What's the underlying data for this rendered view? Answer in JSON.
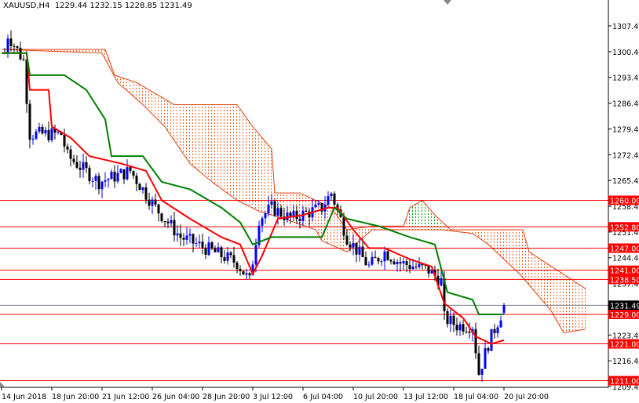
{
  "header": {
    "symbol": "XAUUSD,H4",
    "ohlc": "1229.44 1232.15 1228.85 1231.49"
  },
  "chart_data": {
    "type": "candlestick",
    "title": "XAUUSD,H4",
    "ohlc": {
      "open": 1229.44,
      "high": 1232.15,
      "low": 1228.85,
      "close": 1231.49
    },
    "y_ticks": [
      "1307.40",
      "1300.40",
      "1293.40",
      "1286.40",
      "1279.40",
      "1272.40",
      "1265.40",
      "1258.40",
      "1251.40",
      "1244.40",
      "1237.40",
      "1230.40",
      "1223.40",
      "1216.40",
      "1209.40"
    ],
    "ylim": [
      1207.5,
      1314.5
    ],
    "x_ticks": [
      {
        "bar": 0,
        "label": "14 Jun 2018"
      },
      {
        "bar": 16,
        "label": "18 Jun 20:00"
      },
      {
        "bar": 32,
        "label": "21 Jun 12:00"
      },
      {
        "bar": 48,
        "label": "26 Jun 04:00"
      },
      {
        "bar": 64,
        "label": "28 Jun 20:00"
      },
      {
        "bar": 80,
        "label": "3 Jul 12:00"
      },
      {
        "bar": 96,
        "label": "6 Jul 04:00"
      },
      {
        "bar": 112,
        "label": "10 Jul 20:00"
      },
      {
        "bar": 128,
        "label": "13 Jul 12:00"
      },
      {
        "bar": 144,
        "label": "18 Jul 04:00"
      },
      {
        "bar": 160,
        "label": "20 Jul 20:00"
      }
    ],
    "levels": [
      {
        "price": 1260.0,
        "label": "1260.00"
      },
      {
        "price": 1252.8,
        "label": "1252.80"
      },
      {
        "price": 1247.0,
        "label": "1247.00"
      },
      {
        "price": 1241.0,
        "label": "1241.00"
      },
      {
        "price": 1238.5,
        "label": "1238.50"
      },
      {
        "price": 1229.0,
        "label": "1229.00"
      },
      {
        "price": 1221.0,
        "label": "1221.00"
      },
      {
        "price": 1211.0,
        "label": "1211.00"
      }
    ],
    "current_price": {
      "price": 1231.49,
      "label": "1231.49"
    },
    "close_path": [
      [
        1,
        1300
      ],
      [
        2,
        1305
      ],
      [
        7,
        1298
      ],
      [
        9,
        1278
      ],
      [
        19,
        1278
      ],
      [
        21,
        1272
      ],
      [
        31,
        1265
      ],
      [
        41,
        1268
      ],
      [
        49,
        1258
      ],
      [
        57,
        1250
      ],
      [
        65,
        1247
      ],
      [
        75,
        1243
      ],
      [
        79,
        1238
      ],
      [
        82,
        1255
      ],
      [
        86,
        1258
      ],
      [
        92,
        1255
      ],
      [
        102,
        1258
      ],
      [
        105,
        1262
      ],
      [
        110,
        1250
      ],
      [
        117,
        1242
      ],
      [
        122,
        1246
      ],
      [
        127,
        1243
      ],
      [
        136,
        1241
      ],
      [
        140,
        1238
      ],
      [
        141,
        1228
      ],
      [
        145,
        1226
      ],
      [
        150,
        1226
      ],
      [
        152,
        1213
      ],
      [
        155,
        1221
      ],
      [
        160,
        1231
      ]
    ],
    "tenkan": [
      [
        0,
        1300
      ],
      [
        8,
        1300
      ],
      [
        9,
        1290
      ],
      [
        15,
        1290
      ],
      [
        16,
        1280
      ],
      [
        22,
        1277
      ],
      [
        28,
        1272
      ],
      [
        38,
        1270
      ],
      [
        46,
        1268
      ],
      [
        51,
        1260
      ],
      [
        60,
        1255
      ],
      [
        70,
        1250
      ],
      [
        76,
        1248
      ],
      [
        80,
        1240
      ],
      [
        83,
        1245
      ],
      [
        88,
        1255
      ],
      [
        96,
        1256
      ],
      [
        104,
        1258
      ],
      [
        107,
        1258
      ],
      [
        112,
        1252
      ],
      [
        117,
        1247
      ],
      [
        122,
        1247
      ],
      [
        130,
        1244
      ],
      [
        137,
        1242
      ],
      [
        141,
        1232
      ],
      [
        147,
        1228
      ],
      [
        151,
        1223
      ],
      [
        156,
        1221
      ],
      [
        160,
        1222
      ]
    ],
    "kijun": [
      [
        0,
        1300
      ],
      [
        8,
        1300
      ],
      [
        9,
        1294
      ],
      [
        20,
        1294
      ],
      [
        27,
        1290
      ],
      [
        33,
        1282
      ],
      [
        35,
        1272
      ],
      [
        45,
        1272
      ],
      [
        51,
        1265
      ],
      [
        60,
        1263
      ],
      [
        70,
        1258
      ],
      [
        76,
        1254
      ],
      [
        80,
        1248
      ],
      [
        86,
        1250
      ],
      [
        102,
        1250
      ],
      [
        106,
        1258
      ],
      [
        110,
        1255
      ],
      [
        120,
        1253
      ],
      [
        130,
        1250
      ],
      [
        138,
        1248
      ],
      [
        142,
        1235
      ],
      [
        150,
        1233
      ],
      [
        152,
        1229
      ],
      [
        160,
        1229
      ]
    ],
    "cloud_top": [
      [
        0,
        1301
      ],
      [
        33,
        1301
      ],
      [
        36,
        1294
      ],
      [
        43,
        1292
      ],
      [
        55,
        1286
      ],
      [
        75,
        1286
      ],
      [
        80,
        1280
      ],
      [
        86,
        1274
      ],
      [
        87,
        1262
      ],
      [
        95,
        1262
      ],
      [
        105,
        1258
      ],
      [
        110,
        1252
      ],
      [
        118,
        1253
      ],
      [
        128,
        1253
      ],
      [
        130,
        1258
      ],
      [
        134,
        1260
      ],
      [
        138,
        1256
      ],
      [
        143,
        1252
      ],
      [
        150,
        1252
      ],
      [
        166,
        1252
      ],
      [
        168,
        1246
      ],
      [
        177,
        1241
      ],
      [
        186,
        1236
      ]
    ],
    "cloud_bottom": [
      [
        0,
        1301
      ],
      [
        32,
        1300
      ],
      [
        37,
        1292
      ],
      [
        45,
        1286
      ],
      [
        52,
        1280
      ],
      [
        60,
        1270
      ],
      [
        67,
        1265
      ],
      [
        75,
        1260
      ],
      [
        82,
        1257
      ],
      [
        90,
        1255
      ],
      [
        100,
        1252
      ],
      [
        102,
        1249
      ],
      [
        110,
        1246
      ],
      [
        118,
        1252
      ],
      [
        130,
        1252
      ],
      [
        140,
        1252
      ],
      [
        150,
        1251
      ],
      [
        155,
        1248
      ],
      [
        165,
        1240
      ],
      [
        175,
        1230
      ],
      [
        179,
        1224
      ],
      [
        186,
        1225
      ]
    ],
    "bullish_cloud_range": [
      129,
      143
    ],
    "colors": {
      "bull": "#0000ff",
      "bear": "#000000",
      "tenkan": "#ff0000",
      "kijun": "#008000",
      "cloud_bear": "#ff6020",
      "cloud_bull": "#00a000",
      "level": "#ff0000"
    }
  }
}
